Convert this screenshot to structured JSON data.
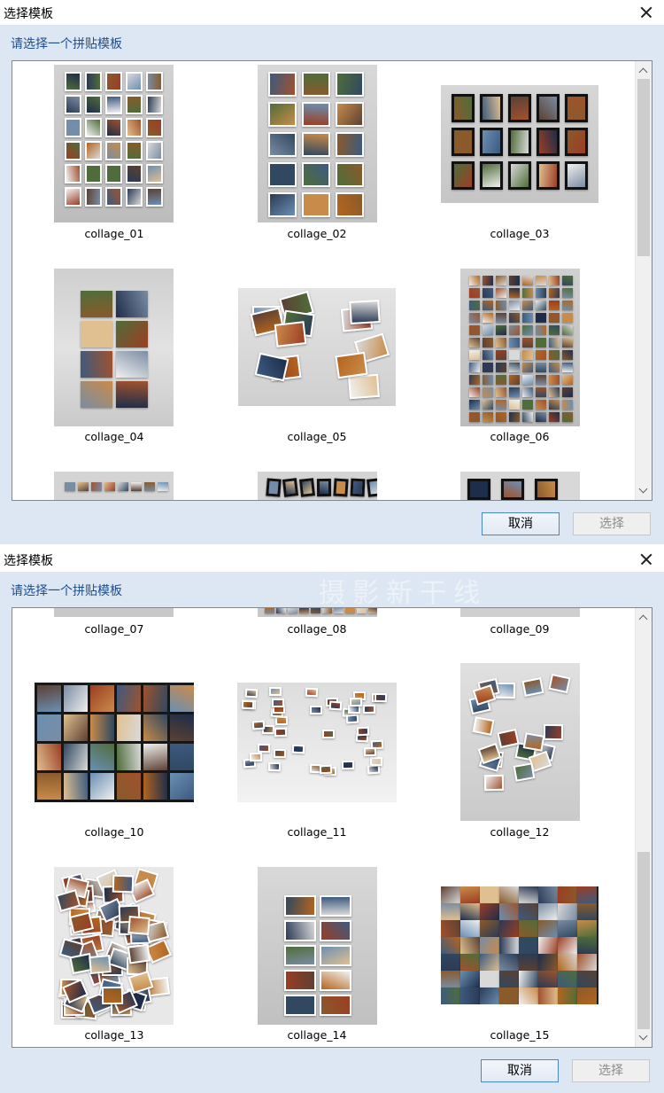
{
  "dialog1": {
    "title": "选择模板",
    "prompt": "请选择一个拼贴模板",
    "cancel_label": "取消",
    "select_label": "选择",
    "items": [
      {
        "name": "collage_01"
      },
      {
        "name": "collage_02"
      },
      {
        "name": "collage_03"
      },
      {
        "name": "collage_04"
      },
      {
        "name": "collage_05"
      },
      {
        "name": "collage_06"
      }
    ]
  },
  "dialog2": {
    "title": "选择模板",
    "prompt": "请选择一个拼贴模板",
    "cancel_label": "取消",
    "select_label": "选择",
    "items": [
      {
        "name": "collage_07"
      },
      {
        "name": "collage_08"
      },
      {
        "name": "collage_09"
      },
      {
        "name": "collage_10"
      },
      {
        "name": "collage_11"
      },
      {
        "name": "collage_12"
      },
      {
        "name": "collage_13"
      },
      {
        "name": "collage_14"
      },
      {
        "name": "collage_15"
      }
    ],
    "watermark": "摄影新干线"
  },
  "colors": {
    "dialog_bg": "#dce7f3",
    "prompt_text": "#1f4e8c",
    "focus_border": "#4a86c8",
    "disabled_text": "#8b8b8b"
  },
  "icons": {
    "close": "close-icon",
    "scroll_up": "chevron-up-icon",
    "scroll_down": "chevron-down-icon"
  }
}
